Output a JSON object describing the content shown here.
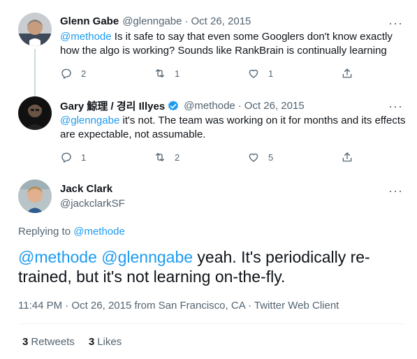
{
  "tweets": [
    {
      "name": "Glenn Gabe",
      "handle": "@glenngabe",
      "date": "Oct 26, 2015",
      "mention": "@methode",
      "text": " Is it safe to say that even some Googlers don't know exactly how the algo is working? Sounds like RankBrain is continually learning",
      "replies": "2",
      "retweets": "1",
      "likes": "1"
    },
    {
      "name": "Gary 鯨理 / 경리 Illyes",
      "handle": "@methode",
      "date": "Oct 26, 2015",
      "mention": "@glenngabe",
      "text": " it's not. The team was working on it for months and its effects are expectable, not assumable.",
      "replies": "1",
      "retweets": "2",
      "likes": "5"
    }
  ],
  "main": {
    "name": "Jack Clark",
    "handle": "@jackclarkSF",
    "replying_label": "Replying to",
    "replying_handle": "@methode",
    "mention1": "@methode",
    "mention2": "@glenngabe",
    "text": " yeah. It's periodically re-trained, but it's not learning on-the-fly.",
    "meta": "11:44 PM · Oct 26, 2015 from San Francisco, CA · Twitter Web Client",
    "retweets_count": "3",
    "retweets_label": "Retweets",
    "likes_count": "3",
    "likes_label": "Likes"
  },
  "more_label": "···",
  "separator": "·",
  "colors": {
    "link": "#1d9bf0",
    "secondary": "#536471",
    "primary": "#0f1419",
    "thread_line": "#cfd9de"
  },
  "icons": [
    "reply-icon",
    "retweet-icon",
    "like-icon",
    "share-icon",
    "verified-badge-icon",
    "more-icon"
  ]
}
